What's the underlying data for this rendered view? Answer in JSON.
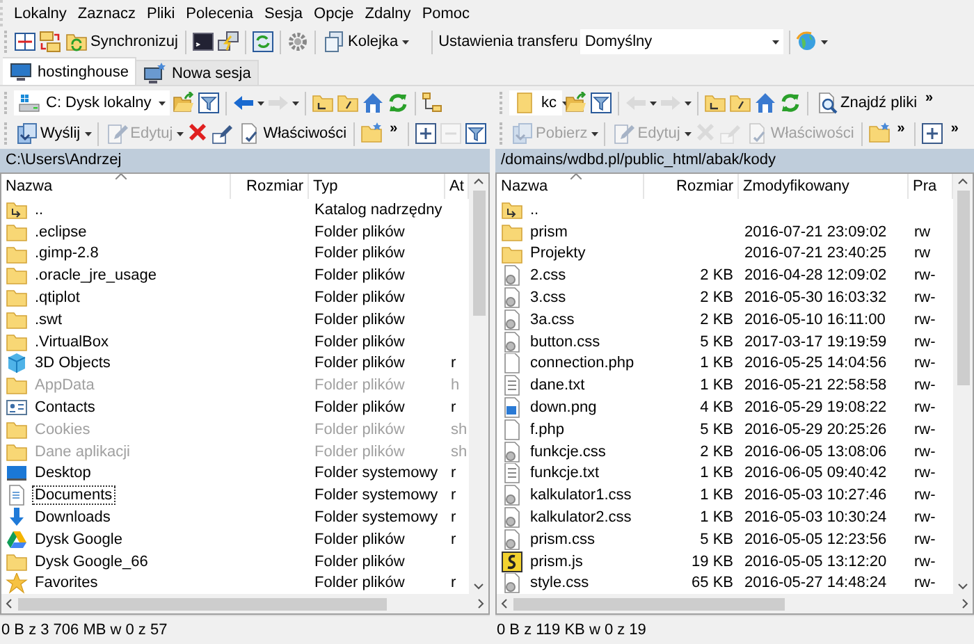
{
  "menu": [
    "Lokalny",
    "Zaznacz",
    "Pliki",
    "Polecenia",
    "Sesja",
    "Opcje",
    "Zdalny",
    "Pomoc"
  ],
  "toolbar": {
    "synchronize": "Synchronizuj",
    "queue": "Kolejka",
    "transfer_label": "Ustawienia transferu",
    "transfer_value": "Domyślny"
  },
  "tabs": [
    {
      "label": "hostinghouse",
      "selected": true
    },
    {
      "label": "Nowa sesja",
      "selected": false
    }
  ],
  "panels": [
    {
      "location": "C: Dysk lokalny",
      "nav": {
        "back_disabled": false,
        "forward_disabled": true
      },
      "actions": [
        {
          "label": "Wyślij",
          "disabled": false
        },
        {
          "label": "Edytuj",
          "disabled": true
        },
        {
          "label": "Właściwości",
          "disabled": false
        }
      ],
      "overflow": [
        "»"
      ],
      "path": "C:\\Users\\Andrzej",
      "columns": [
        "Nazwa",
        "Rozmiar",
        "Typ",
        "At"
      ],
      "rows": [
        {
          "kind": "parent",
          "name": "..",
          "type": "Katalog nadrzędny",
          "hidden": false,
          "focused": false
        },
        {
          "kind": "folder",
          "name": ".eclipse",
          "type": "Folder plików",
          "hidden": false,
          "focused": false
        },
        {
          "kind": "folder",
          "name": ".gimp-2.8",
          "type": "Folder plików",
          "hidden": false,
          "focused": false
        },
        {
          "kind": "folder",
          "name": ".oracle_jre_usage",
          "type": "Folder plików",
          "hidden": false,
          "focused": false
        },
        {
          "kind": "folder",
          "name": ".qtiplot",
          "type": "Folder plików",
          "hidden": false,
          "focused": false
        },
        {
          "kind": "folder",
          "name": ".swt",
          "type": "Folder plików",
          "hidden": false,
          "focused": false
        },
        {
          "kind": "folder",
          "name": ".VirtualBox",
          "type": "Folder plików",
          "hidden": false,
          "focused": false
        },
        {
          "kind": "cube",
          "name": "3D Objects",
          "type": "Folder plików",
          "attr": "r",
          "hidden": false,
          "focused": false
        },
        {
          "kind": "folder",
          "name": "AppData",
          "type": "Folder plików",
          "attr": "h",
          "hidden": true,
          "focused": false
        },
        {
          "kind": "contacts",
          "name": "Contacts",
          "type": "Folder plików",
          "attr": "r",
          "hidden": false,
          "focused": false
        },
        {
          "kind": "folder",
          "name": "Cookies",
          "type": "Folder plików",
          "attr": "sh",
          "hidden": true,
          "focused": false
        },
        {
          "kind": "folder",
          "name": "Dane aplikacji",
          "type": "Folder plików",
          "attr": "sh",
          "hidden": true,
          "focused": false
        },
        {
          "kind": "desktop",
          "name": "Desktop",
          "type": "Folder systemowy",
          "attr": "r",
          "hidden": false,
          "focused": false
        },
        {
          "kind": "documents",
          "name": "Documents",
          "type": "Folder systemowy",
          "attr": "r",
          "hidden": false,
          "focused": true
        },
        {
          "kind": "downloads",
          "name": "Downloads",
          "type": "Folder systemowy",
          "attr": "r",
          "hidden": false,
          "focused": false
        },
        {
          "kind": "drive",
          "name": "Dysk Google",
          "type": "Folder plików",
          "attr": "r",
          "hidden": false,
          "focused": false
        },
        {
          "kind": "folder",
          "name": "Dysk Google_66",
          "type": "Folder plików",
          "hidden": false,
          "focused": false
        },
        {
          "kind": "star",
          "name": "Favorites",
          "type": "Folder plików",
          "attr": "r",
          "hidden": false,
          "focused": false
        }
      ],
      "status": "0 B z 3 706 MB w 0 z 57"
    },
    {
      "location": "kc",
      "nav": {
        "back_disabled": true,
        "forward_disabled": true
      },
      "find": "Znajdź pliki",
      "actions": [
        {
          "label": "Pobierz",
          "disabled": true
        },
        {
          "label": "Edytuj",
          "disabled": true
        },
        {
          "label": "Właściwości",
          "disabled": true
        }
      ],
      "overflow": [
        "»",
        "»",
        "»"
      ],
      "path": "/domains/wdbd.pl/public_html/abak/kody",
      "columns": [
        "Nazwa",
        "Rozmiar",
        "Zmodyfikowany",
        "Pra"
      ],
      "rows": [
        {
          "kind": "parent",
          "name": ".."
        },
        {
          "kind": "folder",
          "name": "prism",
          "modified": "2016-07-21 23:09:02",
          "perms": "rw"
        },
        {
          "kind": "folder",
          "name": "Projekty",
          "modified": "2016-07-21 23:40:25",
          "perms": "rw"
        },
        {
          "kind": "css",
          "name": "2.css",
          "size": "2 KB",
          "modified": "2016-04-28 12:09:02",
          "perms": "rw-"
        },
        {
          "kind": "css",
          "name": "3.css",
          "size": "2 KB",
          "modified": "2016-05-30 16:03:32",
          "perms": "rw-"
        },
        {
          "kind": "css",
          "name": "3a.css",
          "size": "2 KB",
          "modified": "2016-05-10 16:11:00",
          "perms": "rw-"
        },
        {
          "kind": "css",
          "name": "button.css",
          "size": "5 KB",
          "modified": "2017-03-17 19:19:59",
          "perms": "rw-"
        },
        {
          "kind": "file",
          "name": "connection.php",
          "size": "1 KB",
          "modified": "2016-05-25 14:04:56",
          "perms": "rw-"
        },
        {
          "kind": "text",
          "name": "dane.txt",
          "size": "1 KB",
          "modified": "2016-05-21 22:58:58",
          "perms": "rw-"
        },
        {
          "kind": "image",
          "name": "down.png",
          "size": "4 KB",
          "modified": "2016-05-29 19:08:22",
          "perms": "rw-"
        },
        {
          "kind": "file",
          "name": "f.php",
          "size": "5 KB",
          "modified": "2016-05-29 20:25:26",
          "perms": "rw-"
        },
        {
          "kind": "css",
          "name": "funkcje.css",
          "size": "2 KB",
          "modified": "2016-06-05 13:08:06",
          "perms": "rw-"
        },
        {
          "kind": "text",
          "name": "funkcje.txt",
          "size": "1 KB",
          "modified": "2016-06-05 09:40:42",
          "perms": "rw-"
        },
        {
          "kind": "css",
          "name": "kalkulator1.css",
          "size": "1 KB",
          "modified": "2016-05-03 10:27:46",
          "perms": "rw-"
        },
        {
          "kind": "css",
          "name": "kalkulator2.css",
          "size": "1 KB",
          "modified": "2016-05-03 10:30:24",
          "perms": "rw-"
        },
        {
          "kind": "css",
          "name": "prism.css",
          "size": "5 KB",
          "modified": "2016-05-05 12:23:56",
          "perms": "rw-"
        },
        {
          "kind": "script",
          "name": "prism.js",
          "size": "19 KB",
          "modified": "2016-05-05 13:12:20",
          "perms": "rw-"
        },
        {
          "kind": "css",
          "name": "style.css",
          "size": "65 KB",
          "modified": "2016-05-27 14:48:24",
          "perms": "rw-"
        }
      ],
      "status": "0 B z 119 KB w 0 z 19"
    }
  ]
}
